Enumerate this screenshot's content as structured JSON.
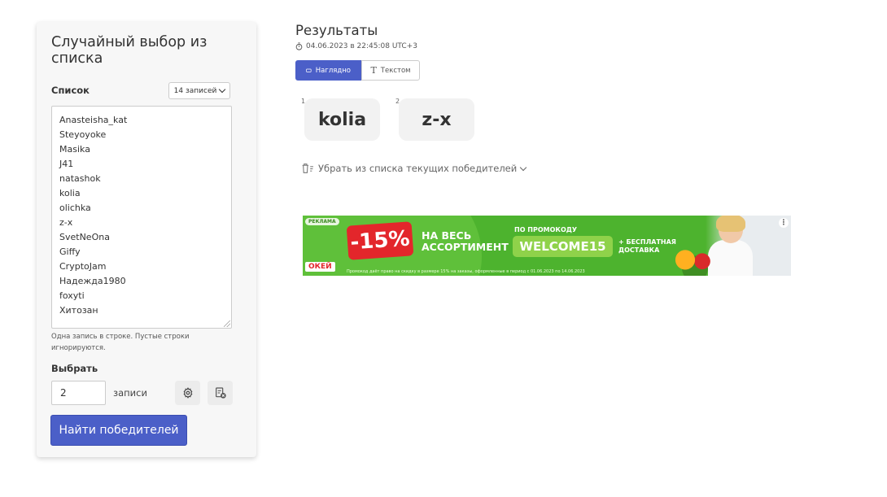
{
  "form": {
    "title": "Случайный выбор из списка",
    "list_label": "Список",
    "count_label": "14 записей",
    "entries": [
      "Anasteisha_kat",
      "Steyoyoke",
      "Masika",
      "J41",
      "natashok",
      "kolia",
      "olichka",
      "z-x",
      "SvetNeOna",
      "Giffy",
      "CryptoJam",
      "Надежда1980",
      "foxyti",
      "Хитозан"
    ],
    "hint": "Одна запись в строке. Пустые строки игнорируются.",
    "choose_label": "Выбрать",
    "choose_value": "2",
    "choose_unit": "записи",
    "find_button": "Найти победителей"
  },
  "results": {
    "title": "Результаты",
    "date": "04.06.2023 в 22:45:08 UTC+3",
    "tabs": [
      "Наглядно",
      "Текстом"
    ],
    "active_tab": "Наглядно",
    "winners": [
      {
        "num": "1",
        "name": "kolia"
      },
      {
        "num": "2",
        "name": "z-x"
      }
    ],
    "remove_link": "Убрать из списка текущих победителей"
  },
  "ad": {
    "label": "РЕКЛАМА",
    "discount": "-15%",
    "line1": "НА ВЕСЬ",
    "line2": "АССОРТИМЕНТ",
    "promo_label": "ПО ПРОМОКОДУ",
    "promo_code": "WELCOME15",
    "free_line1": "+ БЕСПЛАТНАЯ",
    "free_line2": "ДОСТАВКА",
    "logo": "ОКЕЙ",
    "fine_print": "Промокод даёт право на скидку в размере 15% на заказы, оформленные в период с 01.06.2023 по 14.06.2023",
    "menu": "⋮"
  },
  "colors": {
    "accent": "#4b5fc8",
    "ad_green": "#4db32e",
    "ad_red": "#e3262b"
  }
}
